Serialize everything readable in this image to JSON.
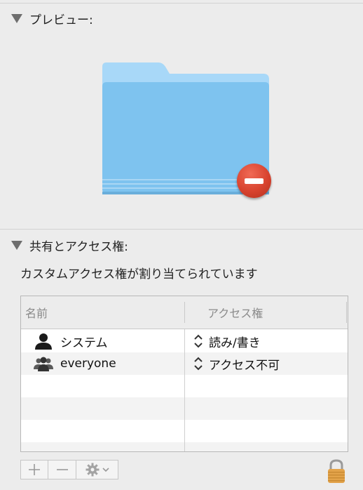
{
  "preview": {
    "header": "プレビュー:",
    "folder_icon": "folder-icon",
    "badge_icon": "no-entry-icon"
  },
  "sharing": {
    "header": "共有とアクセス権:",
    "caption": "カスタムアクセス権が割り当てられています",
    "columns": {
      "name": "名前",
      "access": "アクセス権"
    },
    "rows": [
      {
        "name": "システム",
        "access": "読み/書き",
        "icon": "user-icon"
      },
      {
        "name": "everyone",
        "access": "アクセス不可",
        "icon": "group-icon"
      }
    ]
  },
  "toolbar": {
    "add": "add-icon",
    "remove": "remove-icon",
    "action": "gear-icon",
    "lock": "lock-icon"
  },
  "colors": {
    "folder_light": "#9fd3f6",
    "folder_main": "#7cc1ef",
    "badge": "#d8432f"
  }
}
